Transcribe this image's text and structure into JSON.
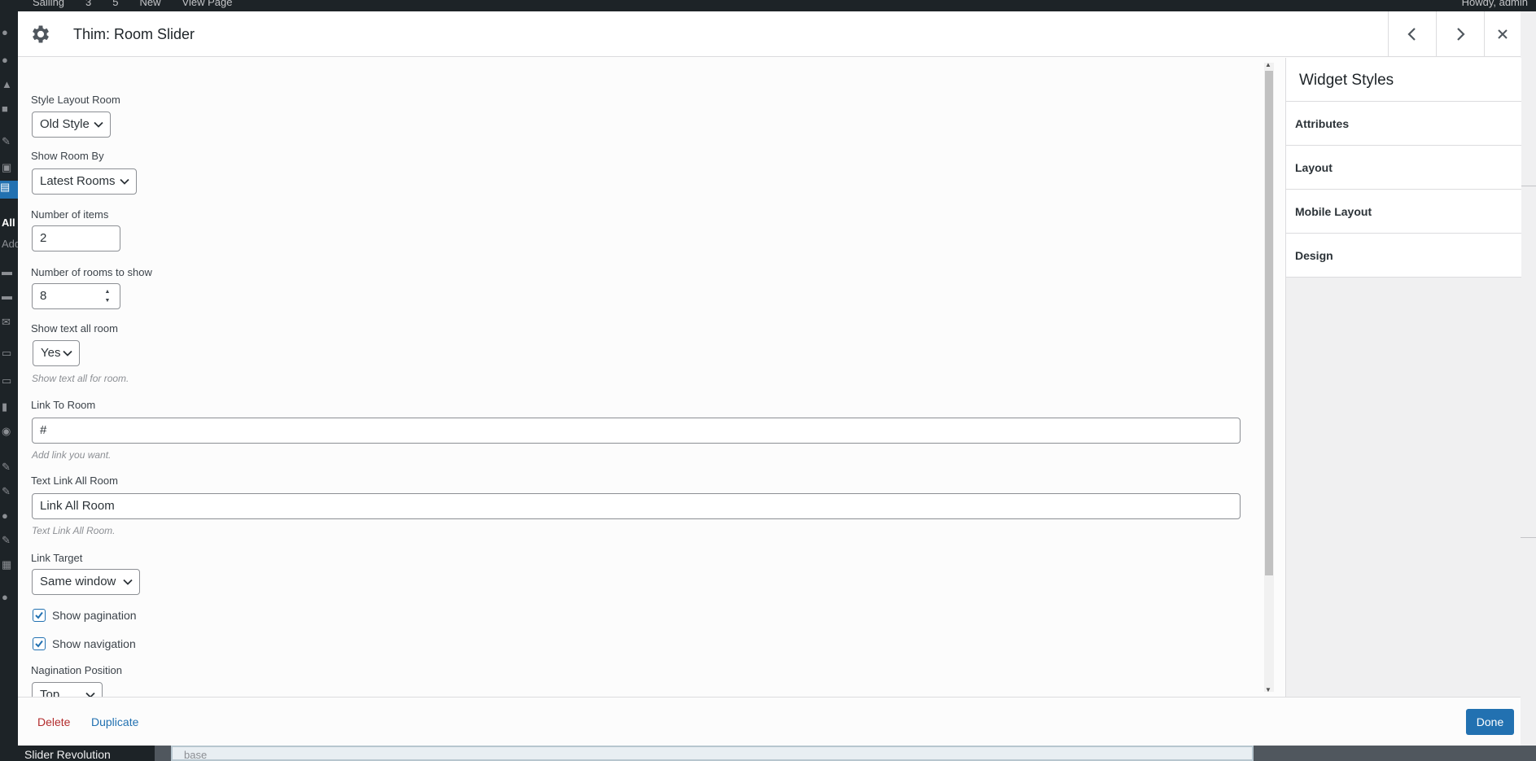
{
  "admin_bar": {
    "site_name": "Sailing",
    "updates_count": "3",
    "comments_count": "5",
    "new_label": "New",
    "view_page_label": "View Page",
    "howdy": "Howdy, admin"
  },
  "admin_menu": {
    "all_label": "All",
    "add_label": "Add"
  },
  "background": {
    "slider_revolution_label": "Slider Revolution",
    "base_label": "base"
  },
  "modal": {
    "title": "Thim: Room Slider",
    "prev_icon": "chevron-left-icon",
    "next_icon": "chevron-right-icon",
    "close_icon": "close-icon",
    "settings_icon": "gear-icon"
  },
  "form": {
    "style_layout": {
      "label": "Style Layout Room",
      "value": "Old Style"
    },
    "show_room_by": {
      "label": "Show Room By",
      "value": "Latest Rooms"
    },
    "number_of_items": {
      "label": "Number of items",
      "value": "2"
    },
    "rooms_to_show": {
      "label": "Number of rooms to show",
      "value": "8"
    },
    "show_text_all": {
      "label": "Show text all room",
      "value": "Yes",
      "description": "Show text all for room."
    },
    "link_to_room": {
      "label": "Link To Room",
      "value": "#",
      "description": "Add link you want."
    },
    "text_link_all": {
      "label": "Text Link All Room",
      "value": "Link All Room",
      "description": "Text Link All Room."
    },
    "link_target": {
      "label": "Link Target",
      "value": "Same window"
    },
    "show_pagination": {
      "label": "Show pagination",
      "checked": true
    },
    "show_navigation": {
      "label": "Show navigation",
      "checked": true
    },
    "navigation_position": {
      "label": "Nagination Position",
      "value": "Top"
    }
  },
  "sidebar": {
    "title": "Widget Styles",
    "items": [
      {
        "label": "Attributes"
      },
      {
        "label": "Layout"
      },
      {
        "label": "Mobile Layout"
      },
      {
        "label": "Design"
      }
    ]
  },
  "footer": {
    "delete_label": "Delete",
    "duplicate_label": "Duplicate",
    "done_label": "Done"
  },
  "colors": {
    "accent": "#2271b1",
    "danger": "#b32d2e",
    "admin_dark": "#1d2327"
  }
}
